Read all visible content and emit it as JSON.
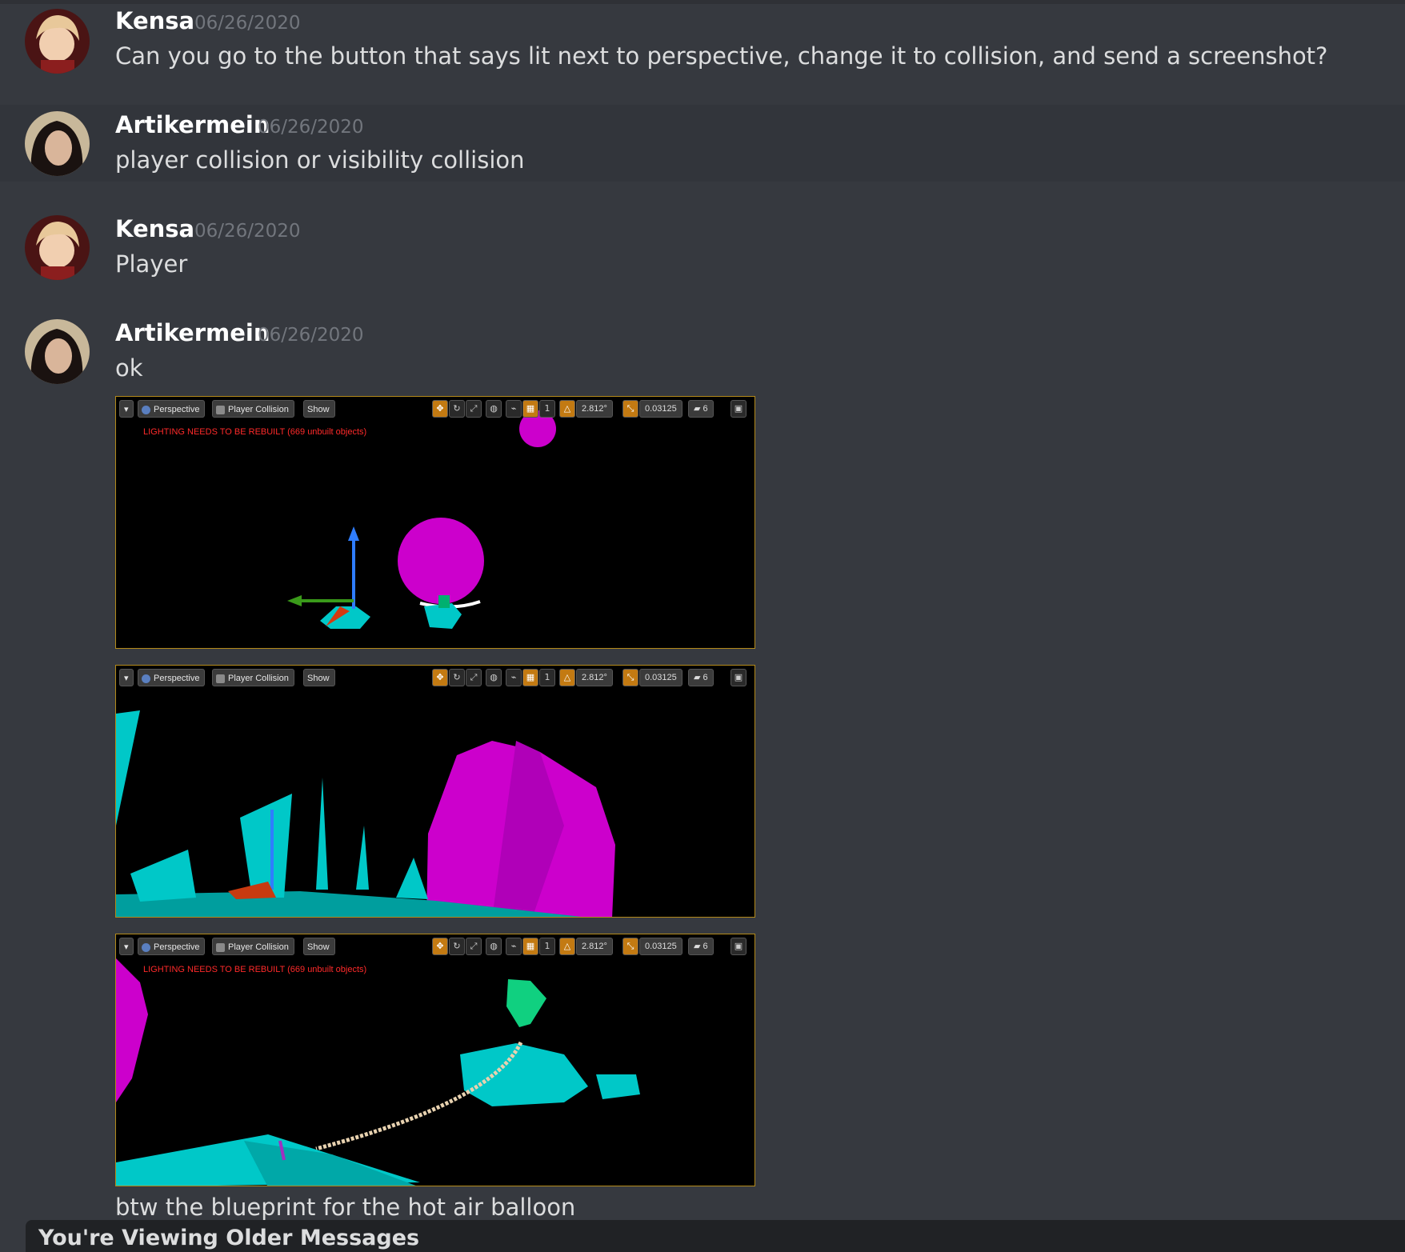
{
  "messages": [
    {
      "author": "Kensa",
      "timestamp": "06/26/2020",
      "text": "Can you go to the button that says lit next to perspective, change it to collision, and send a screenshot?"
    },
    {
      "author": "Artikermein",
      "timestamp": "06/26/2020",
      "text": "player collision or visibility collision"
    },
    {
      "author": "Kensa",
      "timestamp": "06/26/2020",
      "text": "Player"
    },
    {
      "author": "Artikermein",
      "timestamp": "06/26/2020",
      "text": "ok",
      "followup_text": "btw the blueprint for the hot air balloon"
    }
  ],
  "viewport": {
    "menu_arrow": "▾",
    "perspective_label": "Perspective",
    "view_mode_label": "Player Collision",
    "show_label": "Show",
    "rotation_snap": "2.812°",
    "scale_snap": "0.03125",
    "camera_speed": "6",
    "grid_value": "1",
    "warning": "LIGHTING NEEDS TO BE REBUILT (669 unbuilt objects)"
  },
  "banner_text": "You're Viewing Older Messages",
  "colors": {
    "background": "#36393f",
    "username": "#ffffff",
    "timestamp": "#72767d",
    "collision_cyan": "#00c8c8",
    "collision_magenta": "#cc00cc"
  }
}
